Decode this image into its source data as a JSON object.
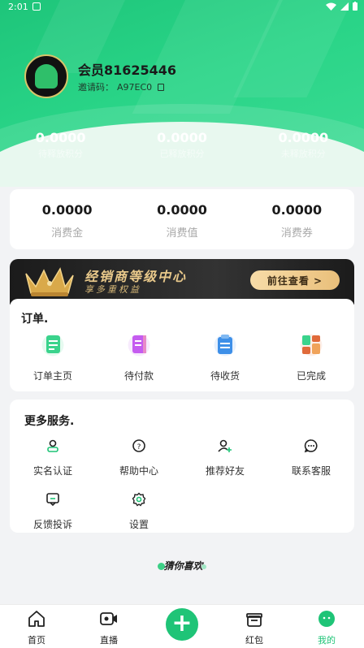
{
  "status_bar": {
    "time": "2:01"
  },
  "profile": {
    "username": "会员81625446",
    "invite_label": "邀请码：",
    "invite_code": "A97EC0"
  },
  "hero_stats": [
    {
      "value": "0.0000",
      "label": "待释放积分"
    },
    {
      "value": "0.0000",
      "label": "已释放积分"
    },
    {
      "value": "0.0000",
      "label": "未释放积分"
    }
  ],
  "wallet_stats": [
    {
      "value": "0.0000",
      "label": "消费金"
    },
    {
      "value": "0.0000",
      "label": "消费值"
    },
    {
      "value": "0.0000",
      "label": "消费券"
    }
  ],
  "banner": {
    "title": "经销商等级中心",
    "subtitle": "享多重权益",
    "button": "前往查看 >"
  },
  "orders": {
    "title": "订单.",
    "items": [
      {
        "label": "订单主页",
        "icon": "order-home-icon",
        "color": "#3ad38c"
      },
      {
        "label": "待付款",
        "icon": "wallet-icon",
        "color": "#c55cf0"
      },
      {
        "label": "待收货",
        "icon": "clipboard-icon",
        "color": "#3d8fe8"
      },
      {
        "label": "已完成",
        "icon": "grid-done-icon",
        "color": "#e06a3a"
      }
    ]
  },
  "services": {
    "title": "更多服务.",
    "items": [
      {
        "label": "实名认证",
        "icon": "user-verify-icon"
      },
      {
        "label": "帮助中心",
        "icon": "help-icon"
      },
      {
        "label": "推荐好友",
        "icon": "add-friend-icon"
      },
      {
        "label": "联系客服",
        "icon": "chat-icon"
      },
      {
        "label": "反馈投诉",
        "icon": "feedback-icon"
      },
      {
        "label": "设置",
        "icon": "settings-icon"
      }
    ]
  },
  "guess_title": "猜你喜欢",
  "tabbar": {
    "items": [
      {
        "label": "首页",
        "icon": "home-icon"
      },
      {
        "label": "直播",
        "icon": "video-icon"
      },
      {
        "label": "红包",
        "icon": "gift-icon"
      },
      {
        "label": "我的",
        "icon": "profile-icon",
        "active": true
      }
    ],
    "plus": "+",
    "accent": "#1fc477"
  }
}
